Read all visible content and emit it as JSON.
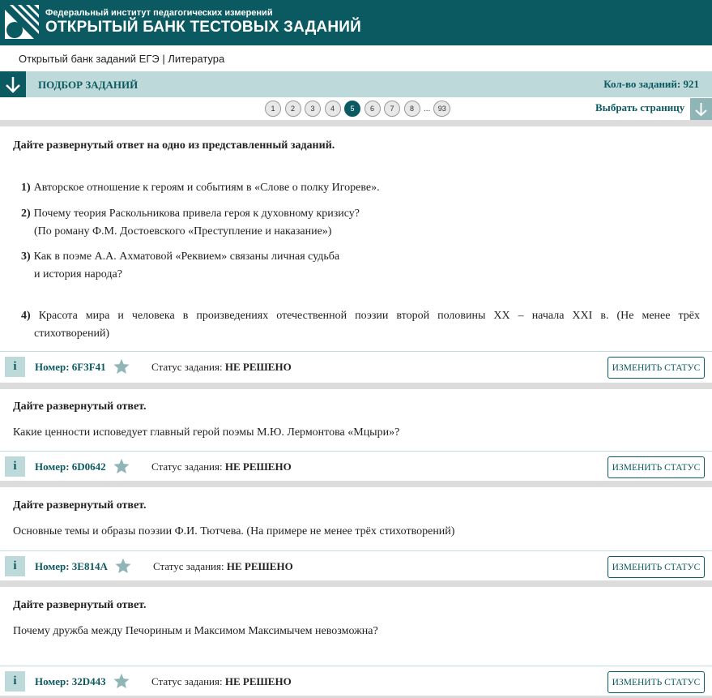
{
  "header": {
    "org": "Федеральный институт педагогических измерений",
    "bank": "ОТКРЫТЫЙ БАНК ТЕСТОВЫХ ЗАДАНИЙ",
    "brand_color": "#0c5a61"
  },
  "breadcrumb": "Открытый банк заданий ЕГЭ | Литература",
  "selection": {
    "title": "ПОДБОР ЗАДАНИЙ",
    "count_label": "Кол-во заданий: 921"
  },
  "pager": {
    "pages": [
      "1",
      "2",
      "3",
      "4",
      "5",
      "6",
      "7",
      "8"
    ],
    "active": "5",
    "ellipsis": "...",
    "last": "93",
    "pick_label": "Выбрать страницу"
  },
  "tasks": [
    {
      "instruction": "Дайте развернутый ответ на одно из представленный заданий.",
      "items": [
        {
          "n": "1)",
          "lines": [
            "Авторское отношение к героям и событиям в «Слове о полку Игореве»."
          ]
        },
        {
          "n": "2)",
          "lines": [
            "Почему теория Раскольникова привела героя к духовному кризису?",
            "(По роману Ф.М. Достоевского «Преступление и наказание»)"
          ]
        },
        {
          "n": "3)",
          "lines": [
            "Как в поэме А.А. Ахматовой «Реквием» связаны личная судьба",
            "и история народа?"
          ]
        },
        {
          "n": "4)",
          "lines": [
            "Красота мира и человека в произведениях отечественной поэзии второй половины XX – начала XXI в. (Не менее трёх",
            "стихотворений)"
          ]
        }
      ],
      "number": "Номер: 6F3F41",
      "status_label": "Статус задания:",
      "status_value": "НЕ РЕШЕНО",
      "button": "ИЗМЕНИТЬ СТАТУС"
    },
    {
      "instruction": "Дайте развернутый ответ.",
      "question": "Какие ценности исповедует главный герой поэмы М.Ю. Лермонтова «Мцыри»?",
      "number": "Номер: 6D0642",
      "status_label": "Статус задания:",
      "status_value": "НЕ РЕШЕНО",
      "button": "ИЗМЕНИТЬ СТАТУС"
    },
    {
      "instruction": "Дайте развернутый ответ.",
      "question": "Основные темы и образы поэзии Ф.И. Тютчева. (На примере не менее трёх стихотворений)",
      "number": "Номер: 3E814A",
      "status_label": "Статус задания:",
      "status_value": "НЕ РЕШЕНО",
      "button": "ИЗМЕНИТЬ СТАТУС"
    },
    {
      "instruction": "Дайте развернутый ответ.",
      "question": "Почему дружба между Печориным и Максимом Максимычем невозможна?",
      "number": "Номер: 32D443",
      "status_label": "Статус задания:",
      "status_value": "НЕ РЕШЕНО",
      "button": "ИЗМЕНИТЬ СТАТУС"
    }
  ],
  "icons": {
    "info": "i",
    "favorite": "star-icon",
    "toggle": "arrow-down-icon"
  }
}
